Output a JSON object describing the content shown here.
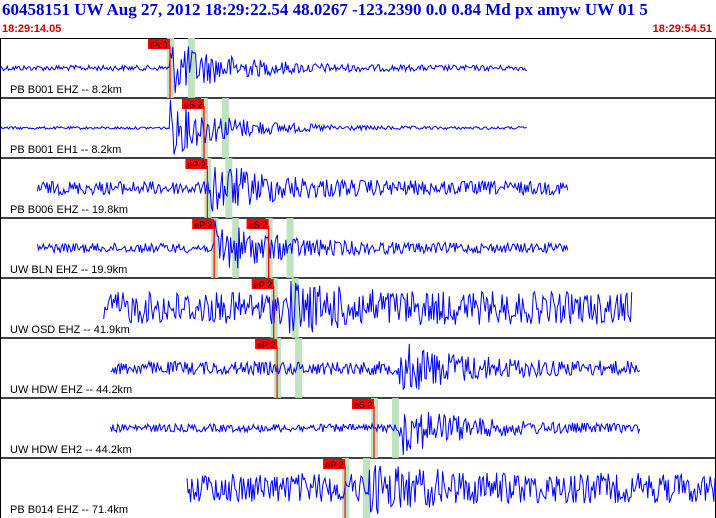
{
  "header": {
    "title": "60458151 UW Aug 27, 2012 18:29:22.54    48.0267 -123.2390  0.0 0.84 Md px amyw UW 01    5",
    "start_time": "18:29:14.05",
    "end_time": "18:29:54.51"
  },
  "colors": {
    "trace": "#0000ff",
    "pick": "#ff0000",
    "window": "#b8e0b8",
    "grid": "#000000",
    "title": "#0000d0"
  },
  "channels": [
    {
      "label": "PB B001 EHZ -- 8.2km",
      "start_s": 0.0,
      "end_s": 31.0,
      "amp": 0.1,
      "burst_s": 10.0,
      "picks": [
        {
          "label": "iPc0",
          "t": 10.0
        }
      ]
    },
    {
      "label": "PB B001 EH1 -- 8.2km",
      "start_s": 0.0,
      "end_s": 31.0,
      "amp": 0.05,
      "burst_s": 10.0,
      "picks": [
        {
          "label": "eS 2",
          "t": 12.0
        }
      ]
    },
    {
      "label": "PB B006 EHZ -- 19.8km",
      "start_s": 2.2,
      "end_s": 33.4,
      "amp": 0.25,
      "burst_s": 12.4,
      "picks": [
        {
          "label": "eP 2",
          "t": 12.2
        }
      ]
    },
    {
      "label": "UW BLN EHZ -- 19.9km",
      "start_s": 2.2,
      "end_s": 33.4,
      "amp": 0.18,
      "burst_s": 12.6,
      "picks": [
        {
          "label": "eP 2",
          "t": 12.6
        },
        {
          "label": "eS 2",
          "t": 15.8
        }
      ]
    },
    {
      "label": "UW OSD EHZ -- 41.9km",
      "start_s": 6.1,
      "end_s": 37.2,
      "amp": 0.6,
      "burst_s": 17.0,
      "picks": [
        {
          "label": "eP 2",
          "t": 16.1
        }
      ]
    },
    {
      "label": "UW HDW EHZ -- 44.2km",
      "start_s": 6.5,
      "end_s": 37.7,
      "amp": 0.25,
      "burst_s": 23.5,
      "picks": [
        {
          "label": "eP 2",
          "t": 16.3
        }
      ]
    },
    {
      "label": "UW HDW EH2 -- 44.2km",
      "start_s": 6.5,
      "end_s": 37.7,
      "amp": 0.15,
      "burst_s": 23.5,
      "picks": [
        {
          "label": "eS 2",
          "t": 22.0
        }
      ]
    },
    {
      "label": "PB B014 EHZ -- 71.4km",
      "start_s": 11.0,
      "end_s": 42.2,
      "amp": 0.55,
      "burst_s": 21.5,
      "picks": [
        {
          "label": "eP 2",
          "t": 20.3
        }
      ]
    }
  ]
}
